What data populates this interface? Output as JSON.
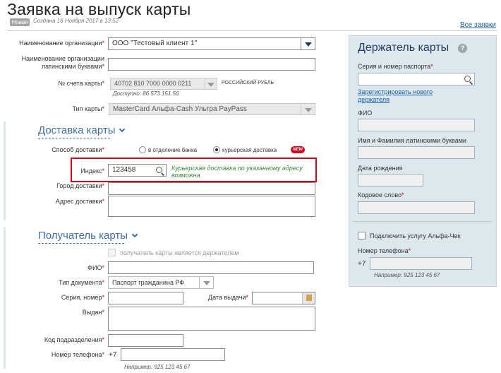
{
  "header": {
    "title": "Заявка на выпуск карты",
    "badge": "Новая",
    "created": "Создана 16 Ноября 2017 в 13:52",
    "all_requests_link": "Все заявки"
  },
  "form": {
    "org_name": {
      "label": "Наименование организации",
      "value": "ООО \"Тестовый клиент 1\""
    },
    "org_name_latin": {
      "label_line1": "Наименование организации",
      "label_line2": "латинскими буквами",
      "value": ""
    },
    "account": {
      "label": "№ счета карты",
      "value": "40702 810 7000 0000 0211",
      "currency": "российский рубль",
      "available": "Доступно: 86 573 151.56"
    },
    "card_type": {
      "label": "Тип карты",
      "value": "MasterCard Альфа-Cash Ультра PayPass"
    }
  },
  "delivery": {
    "title": "Доставка карты",
    "method_label": "Способ доставки",
    "option_bank": "в отделение банка",
    "option_courier": "курьерская доставка",
    "new_badge": "NEW",
    "selected": "courier",
    "index_label": "Индекс",
    "index_value": "123458",
    "index_message": "Курьерская доставка по указанному адресу возможна",
    "city_label": "Город доставки",
    "address_label": "Адрес доставки"
  },
  "recipient": {
    "title": "Получатель карты",
    "is_holder_label": "получатель карты является держателем",
    "fio_label": "ФИО",
    "doc_type_label": "Тип документа",
    "doc_type_value": "Паспорт гражданина РФ",
    "series_label": "Серия, номер",
    "issue_date_label": "Дата выдачи",
    "issued_by_label": "Выдан",
    "division_code_label": "Код подразделения",
    "phone_label": "Номер телефона",
    "phone_prefix": "+7",
    "phone_example": "Например: 925 123 45 67"
  },
  "holder": {
    "title": "Держатель карты",
    "help": "?",
    "passport_label": "Серия и номер паспорта",
    "register_link": "Зарегистрировать нового держателя",
    "fio_label": "ФИО",
    "latin_label": "Имя и Фамилия латинскими буквами",
    "birth_label": "Дата рождения",
    "codeword_label": "Кодовое слово",
    "alfacheck_label": "Подключить услугу Альфа-Чек",
    "phone_label": "Номер телефона",
    "phone_prefix": "+7",
    "phone_example": "Например: 925 123 45 67"
  },
  "required_mark": "*",
  "colors": {
    "accent": "#3d6ea8",
    "required": "#d0021b",
    "panel": "#dde7ee",
    "success": "#3a8a3a"
  }
}
